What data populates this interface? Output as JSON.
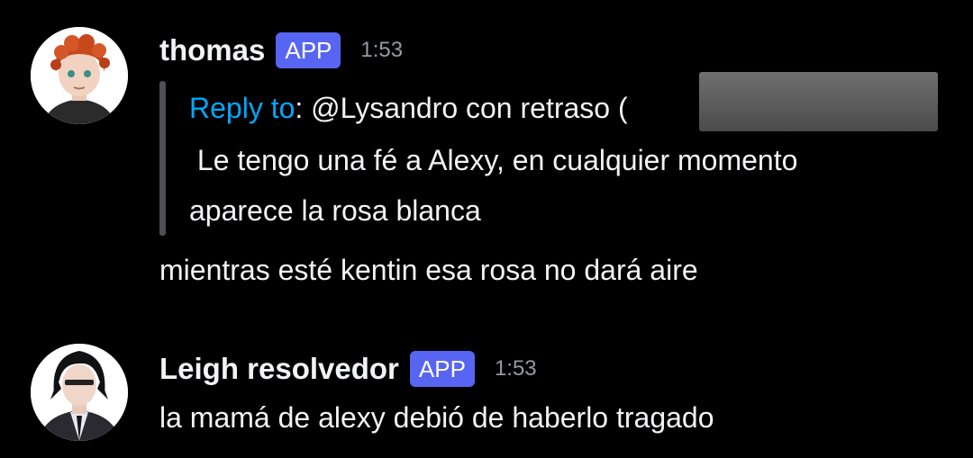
{
  "messages": [
    {
      "username": "thomas",
      "badge": "APP",
      "time": "1:53",
      "reply": {
        "label": "Reply to",
        "separator": ": ",
        "mention": "@Lysandro con retraso (",
        "line2": " Le tengo una fé a Alexy, en cualquier momento",
        "line3": "aparece la rosa blanca"
      },
      "text": "mientras esté kentin esa rosa no dará aire"
    },
    {
      "username": "Leigh resolvedor",
      "badge": "APP",
      "time": "1:53",
      "text": "la mamá de alexy debió de haberlo tragado"
    }
  ],
  "colors": {
    "background": "#000000",
    "badge": "#5865f2",
    "reply_label": "#00a8fc",
    "timestamp": "#949ba4"
  },
  "icons": [
    "avatar-redhead-boy",
    "avatar-dark-haired-man"
  ]
}
